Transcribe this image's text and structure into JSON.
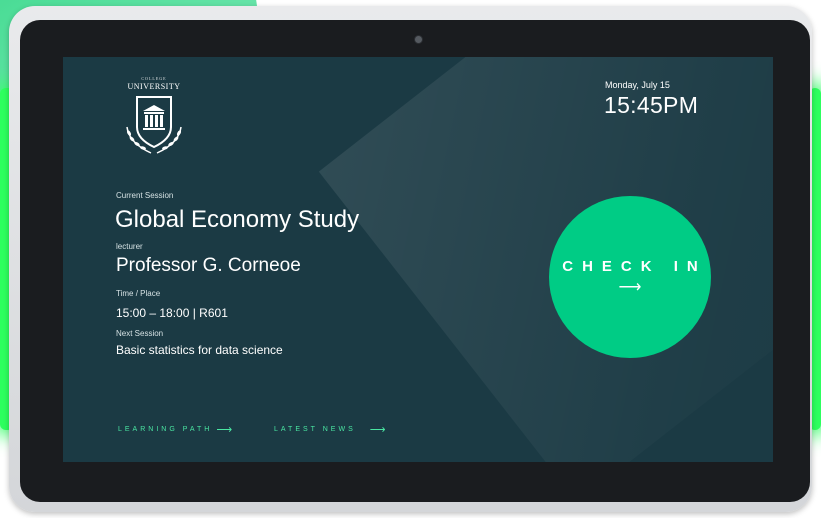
{
  "logo": {
    "top_text": "COLLEGE",
    "name": "UNIVERSITY"
  },
  "header": {
    "date": "Monday, July 15",
    "time": "15:45PM"
  },
  "session": {
    "current_label": "Current Session",
    "title": "Global Economy Study",
    "lecturer_label": "lecturer",
    "lecturer_name": "Professor G. Corneoe",
    "time_place_label": "Time / Place",
    "time_place": "15:00 – 18:00 | R601",
    "next_label": "Next Session",
    "next_title": "Basic statistics for data science"
  },
  "nav": {
    "learning_path": "LEARNING PATH",
    "latest_news": "LATEST NEWS",
    "arrow": "⟶"
  },
  "check_in": {
    "label": "CHECK IN",
    "arrow": "⟶"
  },
  "colors": {
    "screen_bg": "#1b3a44",
    "accent": "#00cc85",
    "nav_accent": "#4ae6a2",
    "led_glow": "#2dff5e"
  }
}
